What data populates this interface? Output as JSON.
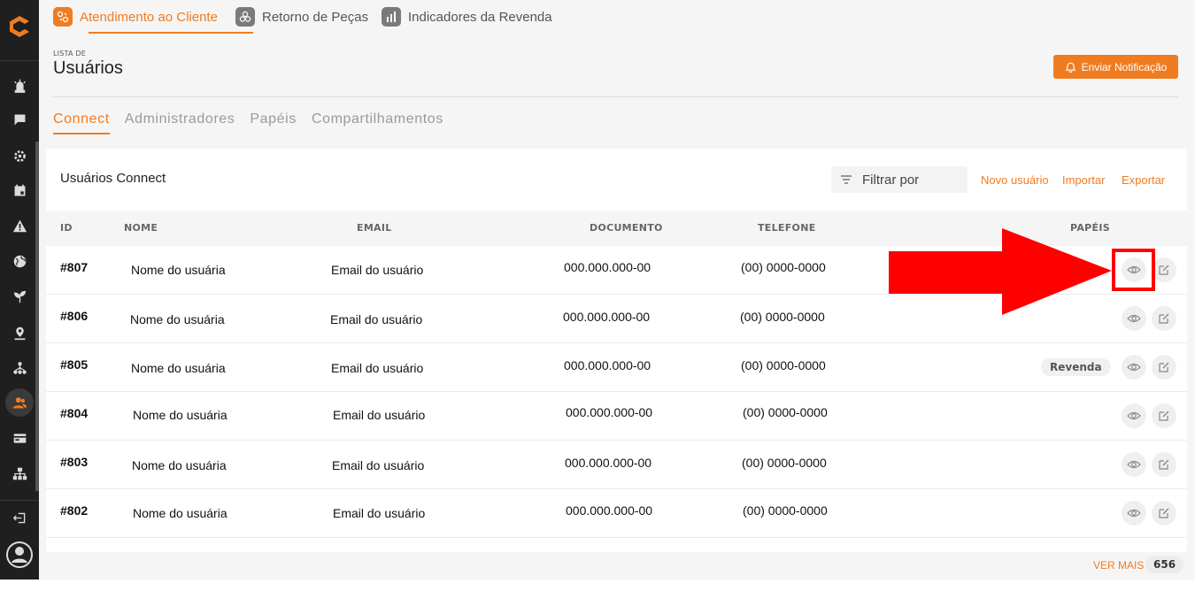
{
  "topnav": {
    "items": [
      {
        "label": "Atendimento ao Cliente",
        "icon": "customer-service-icon",
        "active": true
      },
      {
        "label": "Retorno de Peças",
        "icon": "parts-return-icon",
        "active": false
      },
      {
        "label": "Indicadores da Revenda",
        "icon": "bar-chart-icon",
        "active": false
      }
    ]
  },
  "sidebar": {
    "icons": [
      "alarm-icon",
      "chat-icon",
      "settings-icon",
      "calendar-icon",
      "warning-icon",
      "globe-icon",
      "plant-icon",
      "map-pin-icon",
      "network-icon",
      "users-icon",
      "card-icon",
      "org-chart-icon",
      "logout-icon",
      "account-icon"
    ],
    "active": "users-icon"
  },
  "header": {
    "pre_title": "LISTA DE",
    "title": "Usuários",
    "notify_button": "Enviar Notificação"
  },
  "tabs": [
    {
      "label": "Connect",
      "active": true
    },
    {
      "label": "Administradores",
      "active": false
    },
    {
      "label": "Papéis",
      "active": false
    },
    {
      "label": "Compartilhamentos",
      "active": false
    }
  ],
  "card": {
    "title": "Usuários Connect",
    "filter_placeholder": "Filtrar por",
    "links": {
      "new_user": "Novo usuário",
      "import": "Importar",
      "export": "Exportar"
    }
  },
  "table": {
    "columns": {
      "id": "ID",
      "name": "NOME",
      "email": "EMAIL",
      "document": "DOCUMENTO",
      "phone": "TELEFONE",
      "roles": "PAPÉIS"
    },
    "rows": [
      {
        "id": "#807",
        "name": "Nome do usuária",
        "email": "Email do usuário",
        "document": "000.000.000-00",
        "phone": "(00) 0000-0000",
        "role": ""
      },
      {
        "id": "#806",
        "name": "Nome do usuária",
        "email": "Email do usuário",
        "document": "000.000.000-00",
        "phone": "(00) 0000-0000",
        "role": ""
      },
      {
        "id": "#805",
        "name": "Nome do usuária",
        "email": "Email do usuário",
        "document": "000.000.000-00",
        "phone": "(00) 0000-0000",
        "role": "Revenda"
      },
      {
        "id": "#804",
        "name": "Nome do usuária",
        "email": "Email do usuário",
        "document": "000.000.000-00",
        "phone": "(00) 0000-0000",
        "role": ""
      },
      {
        "id": "#803",
        "name": "Nome do usuária",
        "email": "Email do usuário",
        "document": "000.000.000-00",
        "phone": "(00) 0000-0000",
        "role": ""
      },
      {
        "id": "#802",
        "name": "Nome do usuária",
        "email": "Email do usuário",
        "document": "000.000.000-00",
        "phone": "(00) 0000-0000",
        "role": ""
      }
    ]
  },
  "footer": {
    "see_more": "VER MAIS",
    "count": "656"
  },
  "colors": {
    "accent": "#f07c21",
    "sidebar": "#1f1f1f",
    "annotation": "#ff0000"
  },
  "annotation": {
    "type": "arrow-and-box",
    "target": "view-button row #807"
  }
}
